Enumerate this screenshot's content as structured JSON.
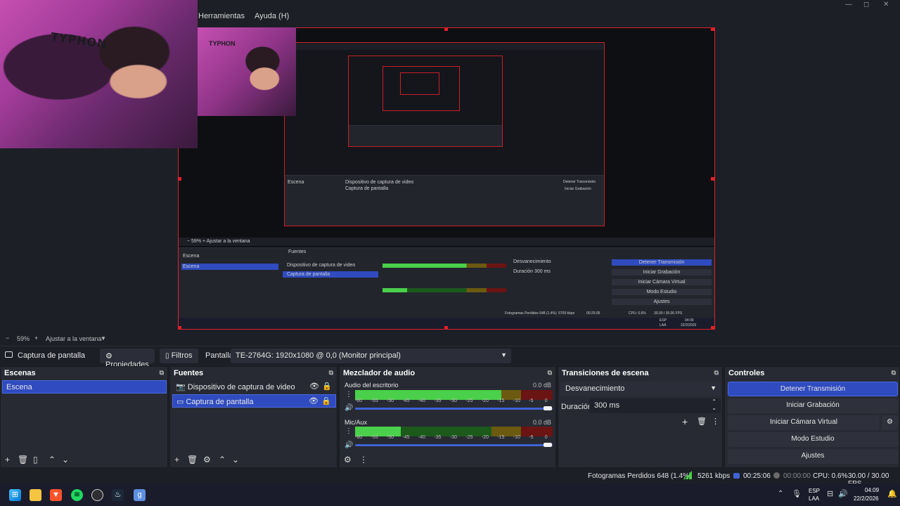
{
  "menu": {
    "tools": "Herramientas",
    "help": "Ayuda (H)"
  },
  "window_controls": {
    "minimize": "—",
    "maximize": "◻",
    "close": "✕"
  },
  "webcam_brand": "TYPHON",
  "zoom": {
    "minus": "−",
    "value": "59%",
    "plus": "+",
    "fit": "Ajustar a la ventana",
    "menu_arrow": "▼"
  },
  "source_bar": {
    "source_name": "Captura de pantalla",
    "properties": "Propiedades",
    "filters": "Filtros",
    "display_label": "Pantalla",
    "display_value": "TE-2764G: 1920x1080 @ 0,0 (Monitor principal)"
  },
  "scenes": {
    "title": "Escenas",
    "items": [
      "Escena"
    ]
  },
  "sources": {
    "title": "Fuentes",
    "items": [
      "Dispositivo de captura de video",
      "Captura de pantalla"
    ]
  },
  "mixer": {
    "title": "Mezclador de audio",
    "tracks": [
      {
        "name": "Audio del escritorio",
        "db": "0.0 dB",
        "level": 0.74
      },
      {
        "name": "Mic/Aux",
        "db": "0.0 dB",
        "level": 0.23
      }
    ],
    "ticks": [
      "-60",
      "-55",
      "-50",
      "-45",
      "-40",
      "-35",
      "-30",
      "-25",
      "-20",
      "-15",
      "-10",
      "-5",
      "0"
    ]
  },
  "transitions": {
    "title": "Transiciones de escena",
    "selected": "Desvanecimiento",
    "duration_label": "Duración",
    "duration_value": "300 ms"
  },
  "controls": {
    "title": "Controles",
    "stop_stream": "Detener Transmisión",
    "start_recording": "Iniciar Grabación",
    "start_virtual_cam": "Iniciar Cámara Virtual",
    "studio_mode": "Modo Estudio",
    "settings": "Ajustes"
  },
  "status": {
    "dropped_frames": "Fotogramas Perdidos 648 (1.4%)",
    "bitrate": "5261 kbps",
    "stream_time": "00:25:06",
    "rec_time": "00:00:00",
    "cpu": "CPU: 0.6%",
    "fps": "30.00 / 30.00 FPS"
  },
  "nested": {
    "sources": [
      "Dispositivo de captura de video",
      "Captura de pantalla"
    ],
    "scene": "Escena",
    "stop": "Detener Transmisión",
    "rec": "Iniciar Grabación",
    "vcam": "Iniciar Cámara Virtual",
    "studio": "Modo Estudio",
    "settings": "Ajustes",
    "dropped": "Fotogramas Perdidos 648 (1.4%)",
    "kbps": "5709 kbps",
    "time": "00:25:05",
    "cpu": "CPU: 0.6%",
    "fps": "30.00 / 30.00 FPS",
    "tray_lang": "ESP",
    "tray_layout": "LAA",
    "tray_time": "04:09",
    "tray_date": "22/2/2026"
  },
  "taskbar": {
    "language": "ESP",
    "layout": "LAA",
    "time": "04:09",
    "date": "22/2/2026"
  },
  "colors": {
    "accent": "#2f4bbf",
    "selection_border": "#e0202a",
    "meter_green": "#4ad04a"
  }
}
